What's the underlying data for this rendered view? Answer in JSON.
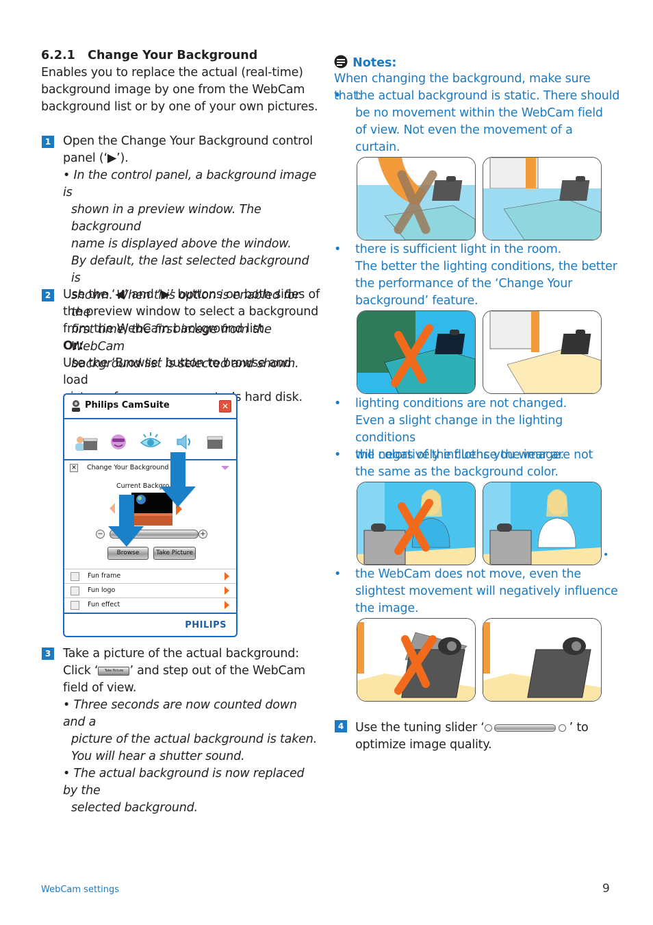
{
  "section": {
    "number": "6.2.1",
    "title": "Change Your Background",
    "intro": [
      "Enables you to replace the actual (real-time)",
      "background image by one from the WebCam",
      "background list or by one of your own pictures."
    ]
  },
  "steps": [
    {
      "num": "1",
      "lines": [
        "Open the Change Your Background control",
        "panel (‘▶’)."
      ],
      "notes": [
        "• In the control panel, a background image is",
        "shown in a preview window. The background",
        "name is displayed above the window.",
        "By default, the last selected background is",
        "shown. When this option is enabled for the",
        "first time, the first image from the WebCam",
        "background list is selected and shown."
      ]
    },
    {
      "num": "2",
      "lines": [
        "Use the ‘◀’ and ‘▶’ buttons on both sides of",
        "the preview window to select a background",
        "from the WebCam background list."
      ],
      "or_label": "Or:",
      "lines2": [
        "Use the ‘Browse’ button to browse and load",
        "pictures from your computer’s hard disk."
      ]
    },
    {
      "num": "3",
      "line1": "Take a picture of the actual background:",
      "line2_pre": "Click ‘",
      "line2_btn": "Take Picture",
      "line2_post": "’ and step out of the WebCam",
      "line3": "field of view.",
      "notes": [
        "• Three seconds are now counted down and a",
        "picture of the actual background is taken.",
        "You will hear a shutter sound.",
        "• The actual background is now replaced by the",
        "selected background."
      ]
    },
    {
      "num": "4",
      "line1_pre": "Use the tuning slider ‘",
      "line1_post": "’ to",
      "line2": "optimize image quality."
    }
  ],
  "app_window": {
    "title": "Philips CamSuite",
    "close": "✕",
    "toolbar_icons": [
      "background-video-icon",
      "smiley-sunglasses-icon",
      "eye-icon",
      "speaker-icon",
      "video-clapper-icon"
    ],
    "panel_title": "Change Your Background",
    "current_label": "Current Backgro",
    "browse_label": "Browse",
    "take_picture_label": "Take Picture",
    "minus": "−",
    "plus": "+",
    "list_items": [
      "Fun frame",
      "Fun logo",
      "Fun effect"
    ],
    "brand": "PHILIPS"
  },
  "notes": {
    "heading": "Notes:",
    "intro": "When changing the background, make sure that:",
    "bullets": [
      {
        "lines": [
          "the actual background is static. There should",
          "be no movement within the WebCam field",
          "of view. Not even the movement of a",
          "curtain."
        ]
      },
      {
        "lines": [
          "there is sufficient light in the room.",
          "The better the lighting conditions, the better",
          "the performance of the ‘Change Your",
          "background’ feature."
        ]
      },
      {
        "lines": [
          "lighting conditions are not changed.",
          "Even a slight change in the lighting conditions",
          "will negatively influence the image."
        ]
      },
      {
        "lines": [
          "the colors of the cloths you wear are not",
          "the same as the background color."
        ]
      },
      {
        "lines": [
          "the WebCam does not move, even the",
          "slightest movement will negatively influence",
          "the image."
        ]
      }
    ],
    "bullet_char": "•",
    "illustrations": [
      {
        "bad": "moving curtain and cat in view",
        "good": "static background"
      },
      {
        "bad": "dark room",
        "good": "well lit room"
      },
      {
        "bad": "clothes same color as background",
        "good": "clothes contrast with background"
      },
      {
        "bad": "webcam moving",
        "good": "webcam steady"
      }
    ]
  },
  "footer": {
    "left": "WebCam settings",
    "page": "9"
  },
  "colors": {
    "accent": "#1a7ac4",
    "window_border": "#1569c7",
    "cross": "#f26a1b"
  }
}
